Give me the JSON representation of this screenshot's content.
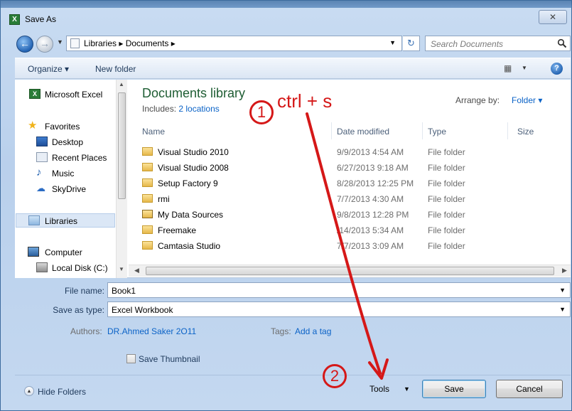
{
  "window": {
    "title": "Save As",
    "close_symbol": "✕"
  },
  "address_bar": {
    "path": "Libraries ▸ Documents ▸",
    "search_placeholder": "Search Documents"
  },
  "toolbar": {
    "organize": "Organize ▾",
    "new_folder": "New folder",
    "help": "?"
  },
  "nav": {
    "items": [
      {
        "label": "Microsoft Excel",
        "icon": "excel-icon"
      },
      {
        "label": "Favorites",
        "icon": "star-icon"
      },
      {
        "label": "Desktop",
        "icon": "desktop-icon"
      },
      {
        "label": "Recent Places",
        "icon": "recent-places-icon"
      },
      {
        "label": "Music",
        "icon": "music-icon"
      },
      {
        "label": "SkyDrive",
        "icon": "skydrive-icon"
      },
      {
        "label": "Libraries",
        "icon": "libraries-icon"
      },
      {
        "label": "Computer",
        "icon": "computer-icon"
      },
      {
        "label": "Local Disk (C:)",
        "icon": "disk-icon"
      }
    ]
  },
  "library": {
    "title": "Documents library",
    "includes_label": "Includes:",
    "includes_link": "2 locations",
    "arrange_label": "Arrange by:",
    "arrange_value": "Folder ▾"
  },
  "columns": {
    "name": "Name",
    "date": "Date modified",
    "type": "Type",
    "size": "Size"
  },
  "files": [
    {
      "name": "Visual Studio 2010",
      "date": "9/9/2013 4:54 AM",
      "type": "File folder"
    },
    {
      "name": "Visual Studio 2008",
      "date": "6/27/2013 9:18 AM",
      "type": "File folder"
    },
    {
      "name": "Setup Factory 9",
      "date": "8/28/2013 12:25 PM",
      "type": "File folder"
    },
    {
      "name": "rmi",
      "date": "7/7/2013 4:30 AM",
      "type": "File folder"
    },
    {
      "name": "My Data Sources",
      "date": "9/8/2013 12:28 PM",
      "type": "File folder"
    },
    {
      "name": "Freemake",
      "date": "/14/2013 5:34 AM",
      "type": "File folder"
    },
    {
      "name": "Camtasia Studio",
      "date": "7/7/2013 3:09 AM",
      "type": "File folder"
    }
  ],
  "form": {
    "file_name_label": "File name:",
    "file_name_value": "Book1",
    "save_type_label": "Save as type:",
    "save_type_value": "Excel Workbook",
    "authors_label": "Authors:",
    "authors_value": "DR.Ahmed Saker 2O11",
    "tags_label": "Tags:",
    "tags_value": "Add a tag",
    "thumbnail_label": "Save Thumbnail"
  },
  "footer": {
    "hide_folders": "Hide Folders",
    "tools": "Tools",
    "save": "Save",
    "cancel": "Cancel"
  },
  "annotations": {
    "step1_number": "1",
    "step1_text": "ctrl + s",
    "step2_number": "2",
    "color": "#d51818"
  },
  "colors": {
    "accent": "#0b63c7",
    "library_title": "#1e5d33",
    "window_bg": "#c4d8f0"
  }
}
